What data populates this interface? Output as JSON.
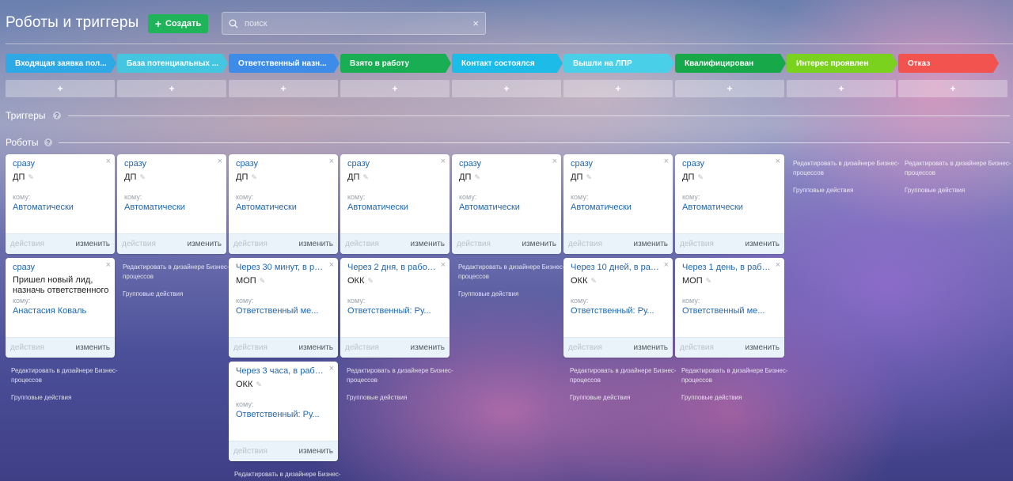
{
  "header": {
    "title": "Роботы и триггеры",
    "create_label": "Создать",
    "search_placeholder": "поиск"
  },
  "stages": [
    {
      "name": "Входящая заявка пол...",
      "color": "#2fa8e6"
    },
    {
      "name": "База потенциальных ...",
      "color": "#45c6e0"
    },
    {
      "name": "Ответственный назн...",
      "color": "#3d8de8"
    },
    {
      "name": "Взято в работу",
      "color": "#1aae54"
    },
    {
      "name": "Контакт состоялся",
      "color": "#1dbbe8"
    },
    {
      "name": "Вышли на ЛПР",
      "color": "#49cfe8"
    },
    {
      "name": "Квалифицирован",
      "color": "#17a84a"
    },
    {
      "name": "Интерес проявлен",
      "color": "#7bd21e"
    },
    {
      "name": "Отказ",
      "color": "#f2534f"
    }
  ],
  "add_label": "+",
  "sections": {
    "triggers": "Триггеры",
    "robots": "Роботы",
    "help": "?"
  },
  "card_ui": {
    "to_label": "кому:",
    "actions_label": "действия",
    "change_label": "изменить",
    "close_glyph": "×",
    "pencil_glyph": "✎"
  },
  "links": {
    "edit_designer": "Редактировать в дизайнере Бизнес-процессов",
    "group_actions": "Групповые действия"
  },
  "robots": {
    "row1": [
      {
        "timing": "сразу",
        "name": "ДП",
        "to": "Автоматически"
      },
      {
        "timing": "сразу",
        "name": "ДП",
        "to": "Автоматически"
      },
      {
        "timing": "сразу",
        "name": "ДП",
        "to": "Автоматически"
      },
      {
        "timing": "сразу",
        "name": "ДП",
        "to": "Автоматически"
      },
      {
        "timing": "сразу",
        "name": "ДП",
        "to": "Автоматически"
      },
      {
        "timing": "сразу",
        "name": "ДП",
        "to": "Автоматически"
      },
      {
        "timing": "сразу",
        "name": "ДП",
        "to": "Автоматически"
      }
    ],
    "row2": {
      "col1": {
        "timing": "сразу",
        "name": "Пришел новый лид, назначь ответственного",
        "to": "Анастасия Коваль"
      },
      "col3": {
        "timing": "Через 30 минут, в раб...",
        "name": "МОП",
        "to": "Ответственный ме..."
      },
      "col4": {
        "timing": "Через 2 дня, в рабоч...",
        "name": "ОКК",
        "to": "Ответственный: Ру..."
      },
      "col6": {
        "timing": "Через 10 дней, в раб...",
        "name": "ОКК",
        "to": "Ответственный: Ру..."
      },
      "col7": {
        "timing": "Через 1 день, в рабо...",
        "name": "МОП",
        "to": "Ответственный ме..."
      }
    },
    "row3": {
      "col3": {
        "timing": "Через 3 часа, в рабо...",
        "name": "ОКК",
        "to": "Ответственный: Ру..."
      }
    }
  }
}
